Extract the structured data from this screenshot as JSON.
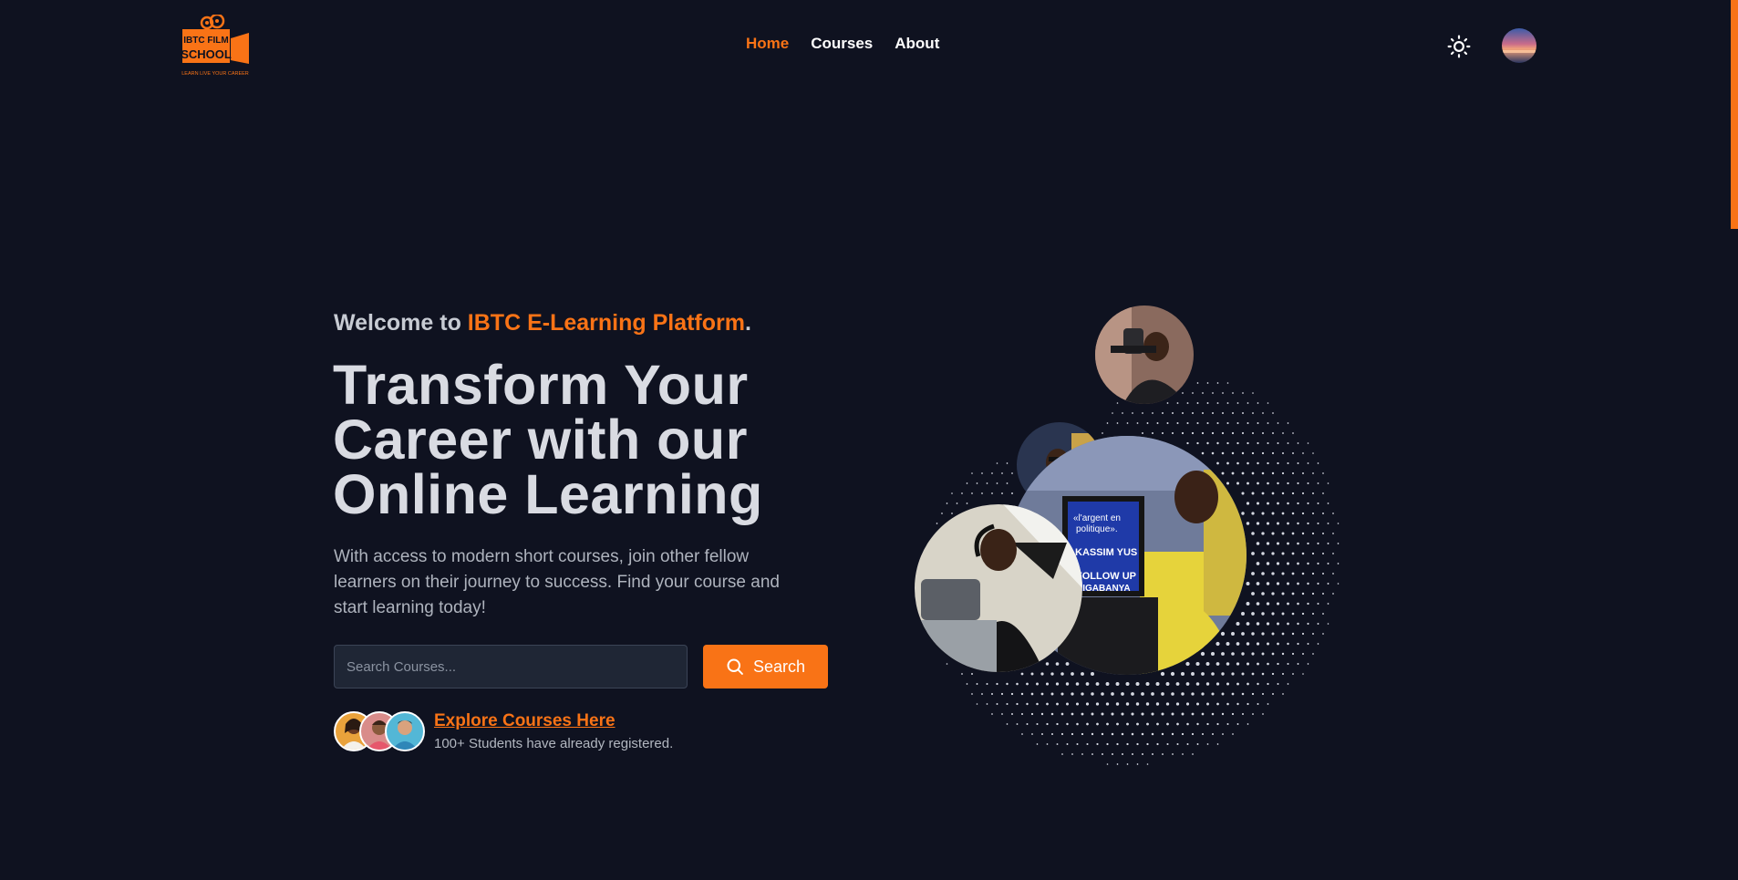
{
  "brand": {
    "logo_line1": "IBTC FILM",
    "logo_line2": "SCHOOL",
    "logo_tagline": "LEARN LIVE YOUR CAREER",
    "accent_color": "#f97316",
    "background_color": "#0f1220"
  },
  "nav": {
    "items": [
      {
        "label": "Home",
        "active": true
      },
      {
        "label": "Courses",
        "active": false
      },
      {
        "label": "About",
        "active": false
      }
    ]
  },
  "header_icons": {
    "theme_toggle": "sun-icon",
    "user_avatar": "user-avatar"
  },
  "hero": {
    "welcome_prefix": "Welcome to ",
    "welcome_highlight": "IBTC E-Learning Platform",
    "welcome_suffix": ".",
    "headline_lines": [
      "Transform Your",
      "Career with our",
      "Online Learning"
    ],
    "description": "With access to modern short courses, join other fellow learners on their journey to success. Find your course and start learning today!"
  },
  "search": {
    "placeholder": "Search Courses...",
    "value": "",
    "button_label": "Search",
    "button_icon": "search-icon"
  },
  "explore": {
    "link_label": "Explore Courses Here",
    "students_text": "100+ Students have already registered."
  },
  "hero_image_text": {
    "screen_line1": "«l'argent en",
    "screen_line2": "politique».",
    "screen_line3": "KASSIM YUS",
    "screen_line4": "FOLLOW UP",
    "screen_line5": "KIGABANYA"
  }
}
